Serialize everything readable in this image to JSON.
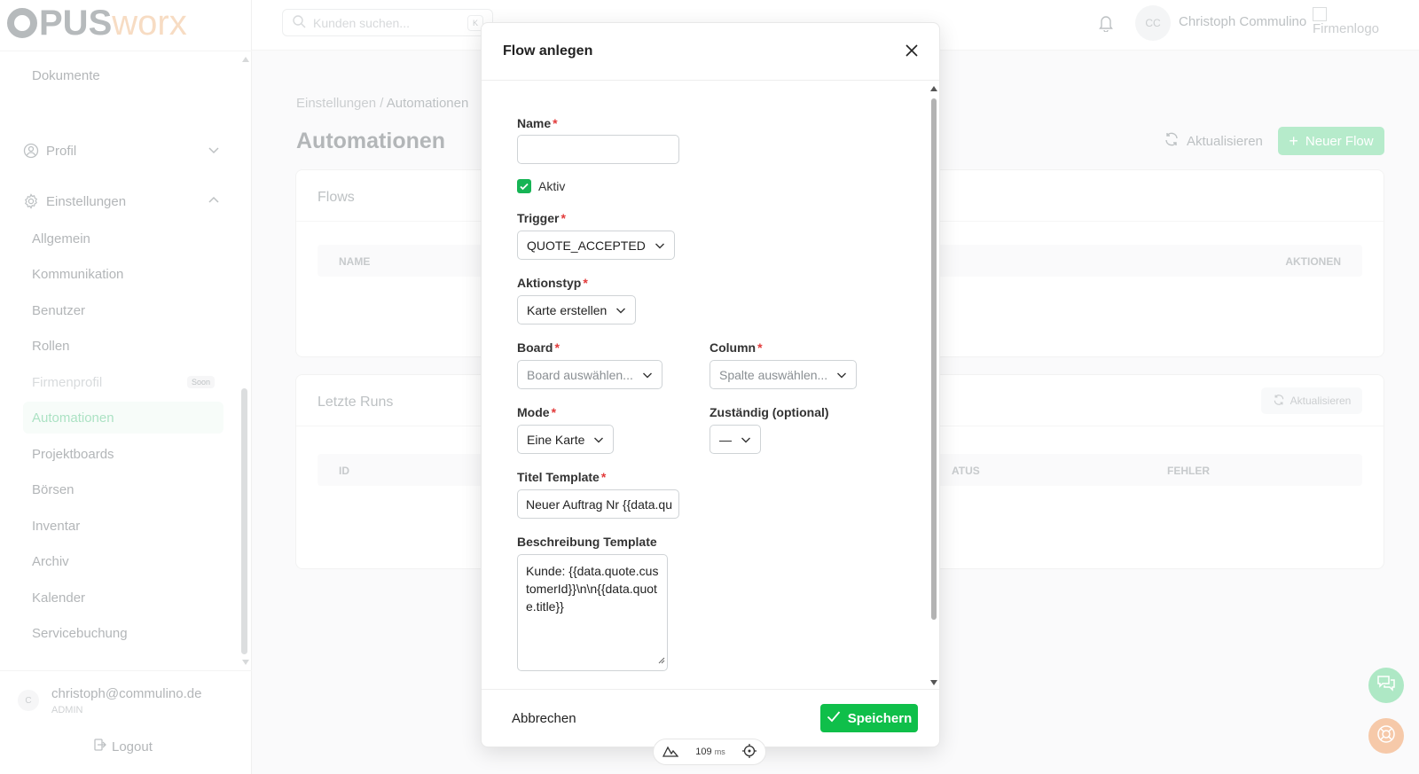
{
  "app": {
    "logo_text_a": "PUS",
    "logo_text_b": "worx"
  },
  "search": {
    "placeholder": "Kunden suchen...",
    "shortcut": "K"
  },
  "user": {
    "initials": "CC",
    "name": "Christoph Commulino",
    "firmenlogo_alt": "Firmenlogo"
  },
  "sidebar": {
    "top_link": "Dokumente",
    "profil_label": "Profil",
    "einstellungen_label": "Einstellungen",
    "items": [
      {
        "label": "Allgemein"
      },
      {
        "label": "Kommunikation"
      },
      {
        "label": "Benutzer"
      },
      {
        "label": "Rollen"
      },
      {
        "label": "Firmenprofil",
        "badge": "Soon"
      },
      {
        "label": "Automationen"
      },
      {
        "label": "Projektboards"
      },
      {
        "label": "Börsen"
      },
      {
        "label": "Inventar"
      },
      {
        "label": "Archiv"
      },
      {
        "label": "Kalender"
      },
      {
        "label": "Servicebuchung"
      }
    ],
    "account": {
      "avatar": "C",
      "email": "christoph@commulino.de",
      "role": "ADMIN"
    },
    "logout_label": "Logout"
  },
  "page": {
    "breadcrumb_parent": "Einstellungen",
    "breadcrumb_sep": " / ",
    "breadcrumb_current": "Automationen",
    "title": "Automationen",
    "refresh_label": "Aktualisieren",
    "new_flow_label": "Neuer Flow"
  },
  "flows_card": {
    "title": "Flows",
    "columns": {
      "name": "NAME",
      "actions": "AKTIONEN"
    }
  },
  "runs_card": {
    "title": "Letzte Runs",
    "refresh_label": "Aktualisieren",
    "columns": {
      "id": "ID",
      "status": "ATUS",
      "error": "FEHLER"
    }
  },
  "modal": {
    "title": "Flow anlegen",
    "name": {
      "label": "Name",
      "value": ""
    },
    "aktiv": {
      "label": "Aktiv",
      "checked": true
    },
    "trigger": {
      "label": "Trigger",
      "value": "QUOTE_ACCEPTED"
    },
    "aktionstyp": {
      "label": "Aktionstyp",
      "value": "Karte erstellen"
    },
    "board": {
      "label": "Board",
      "placeholder": "Board auswählen..."
    },
    "column": {
      "label": "Column",
      "placeholder": "Spalte auswählen..."
    },
    "mode": {
      "label": "Mode",
      "value": "Eine Karte"
    },
    "zustaendig": {
      "label": "Zuständig (optional)",
      "value": "—"
    },
    "titel_template": {
      "label": "Titel Template",
      "value": "Neuer Auftrag Nr {{data.qu"
    },
    "beschreibung_template": {
      "label": "Beschreibung Template",
      "value": "Kunde: {{data.quote.customerId}}\\n\\n{{data.quote.title}}"
    },
    "required_marker": "*",
    "cancel_label": "Abbrechen",
    "save_label": "Speichern"
  },
  "perf": {
    "value": "109",
    "unit": "ms"
  },
  "colors": {
    "primary_green": "#0fbf4a",
    "muted_green": "#8fe0b0",
    "required_red": "#e23b3b"
  }
}
